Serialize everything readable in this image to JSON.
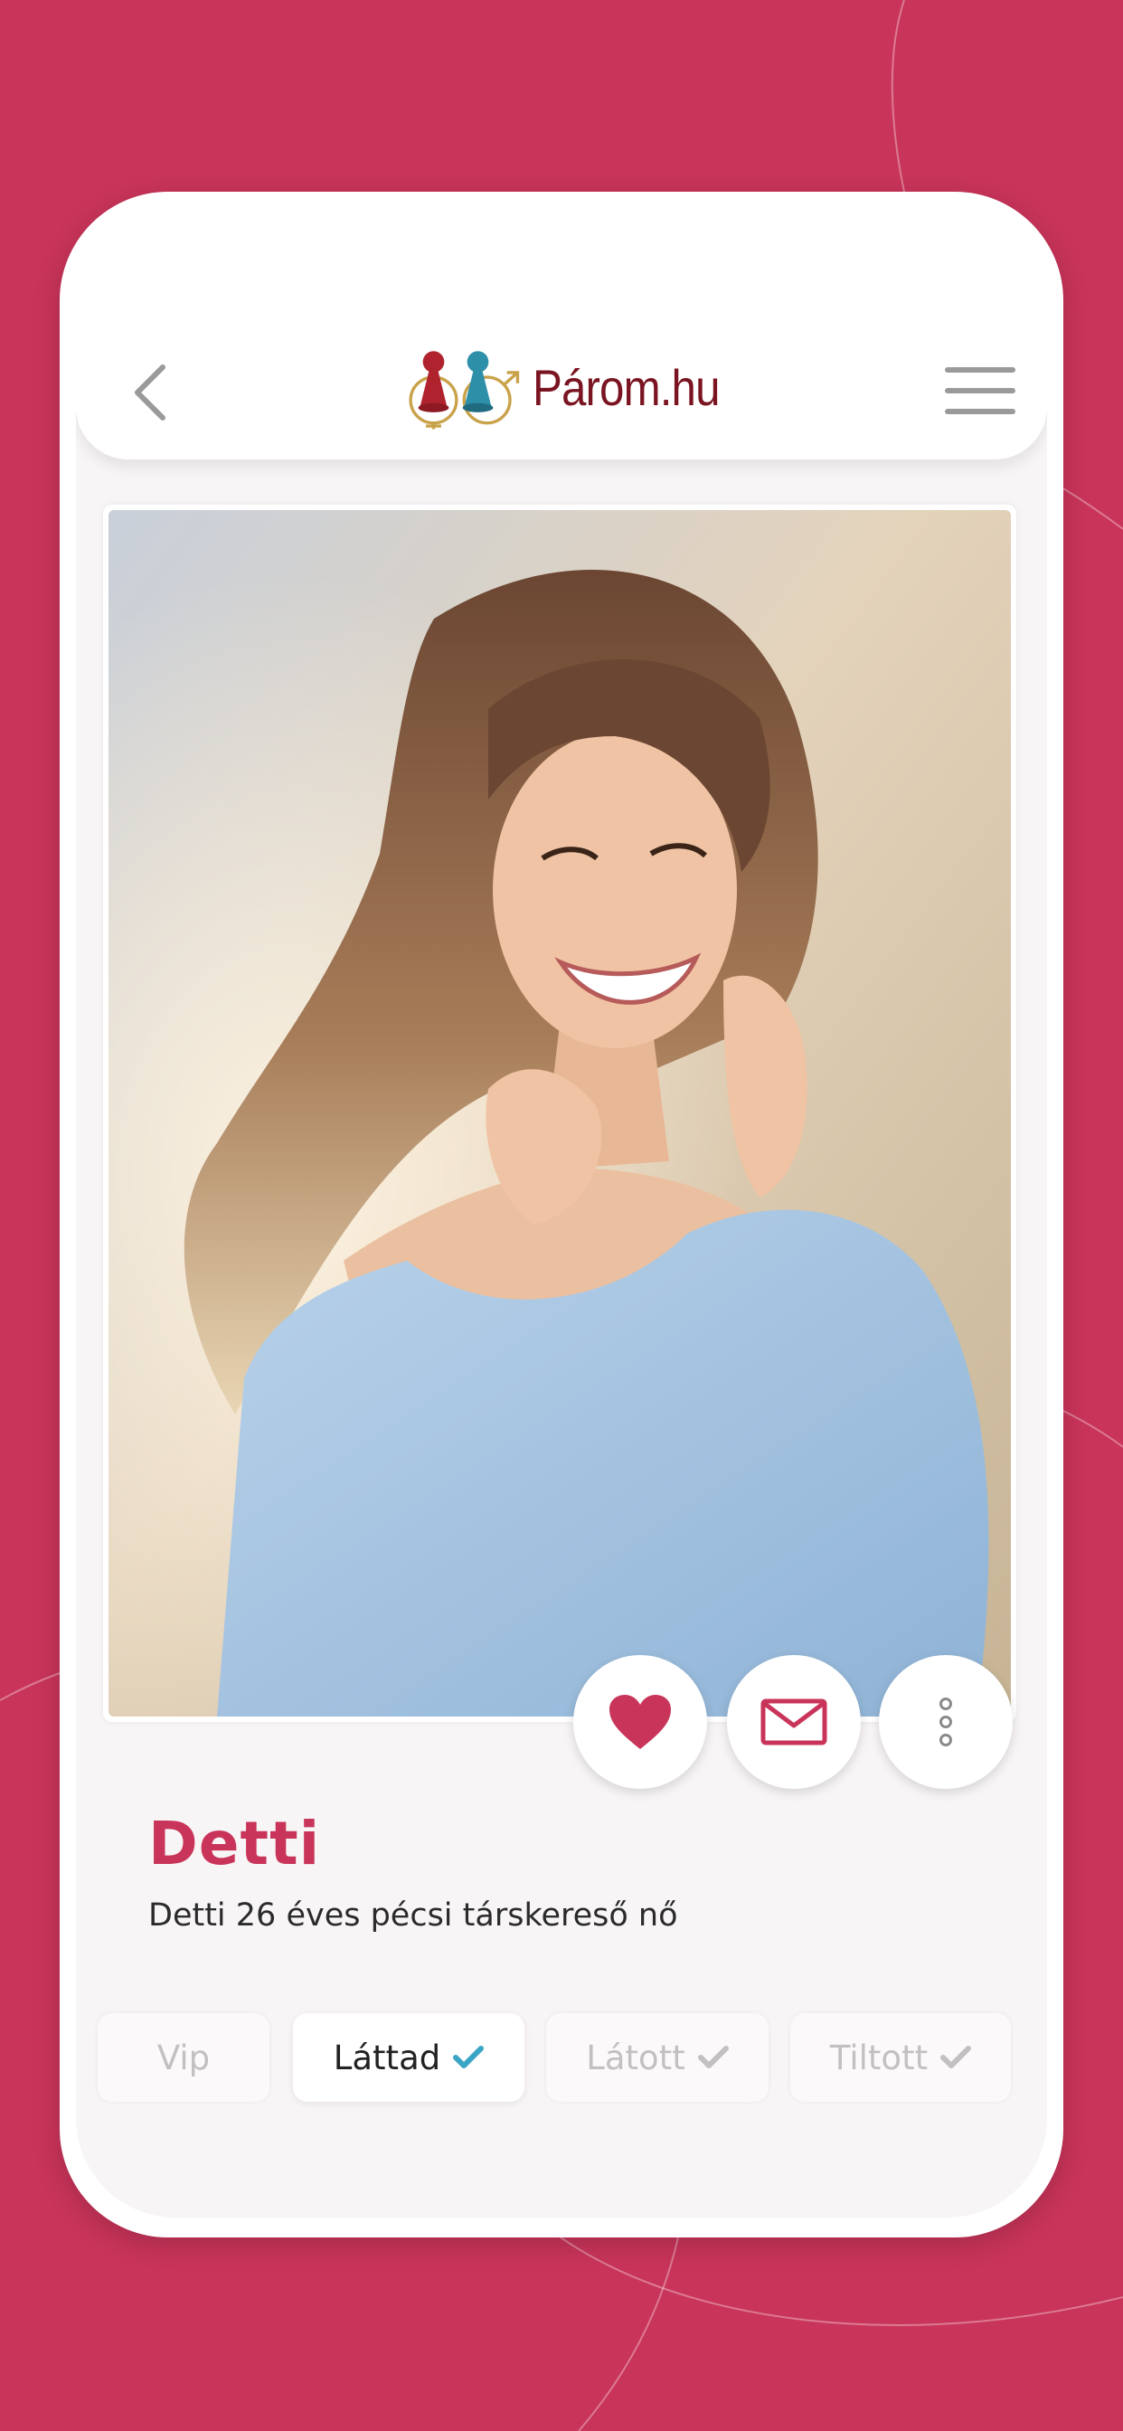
{
  "app": {
    "logo_text": "Párom.hu",
    "accent_color": "#c9345a",
    "logo_color": "#7a1421"
  },
  "header": {
    "back_icon": "chevron-left-icon",
    "menu_icon": "hamburger-menu-icon"
  },
  "profile": {
    "name": "Detti",
    "description": "Detti 26 éves pécsi társkereső nő",
    "photo_alt": "Detti profilképe"
  },
  "actions": [
    {
      "icon": "heart-icon"
    },
    {
      "icon": "envelope-icon"
    },
    {
      "icon": "more-vertical-icon"
    }
  ],
  "status_chips": [
    {
      "label": "Vip",
      "active": false,
      "checked": false
    },
    {
      "label": "Láttad",
      "active": true,
      "checked": true,
      "check_color": "#3aa5c4"
    },
    {
      "label": "Látott",
      "active": false,
      "checked": true
    },
    {
      "label": "Tiltott",
      "active": false,
      "checked": true
    }
  ]
}
